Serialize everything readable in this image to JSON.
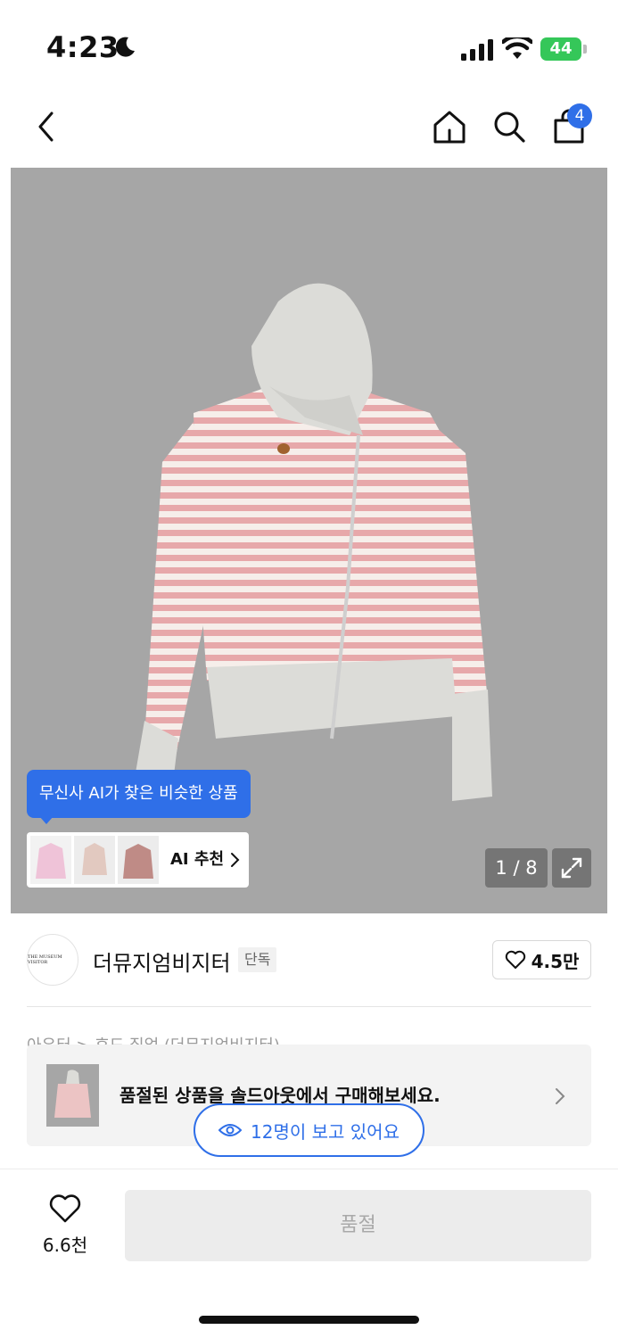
{
  "status_bar": {
    "time": "4:23",
    "battery": "44",
    "icons": [
      "moon-icon",
      "signal-icon",
      "wifi-icon",
      "battery-icon"
    ]
  },
  "nav": {
    "icons": [
      "back-arrow-icon",
      "home-icon",
      "search-icon",
      "shopping-bag-icon"
    ],
    "cart_count": "4"
  },
  "gallery": {
    "ai_tooltip": "무신사 AI가 찾은 비슷한 상품",
    "ai_button_label": "AI 추천",
    "page_counter": "1 / 8",
    "expand_icon": "expand-icon"
  },
  "brand": {
    "logo_text": "THE MUSEUM VISITOR",
    "name": "더뮤지엄비지터",
    "tag": "단독",
    "like_count": "4.5만"
  },
  "breadcrumb_partial": "아우터 > 후드 집업 (더뮤지엄비지터)",
  "soldout_banner": {
    "text": "품절된 상품을 솔드아웃에서 구매해보세요."
  },
  "viewers": {
    "text": "12명이 보고 있어요"
  },
  "bottom_bar": {
    "like_count": "6.6천",
    "buy_button_label": "품절"
  },
  "colors": {
    "accent": "#2f6fe8",
    "image_bg": "#a6a6a6",
    "battery": "#35c759"
  }
}
